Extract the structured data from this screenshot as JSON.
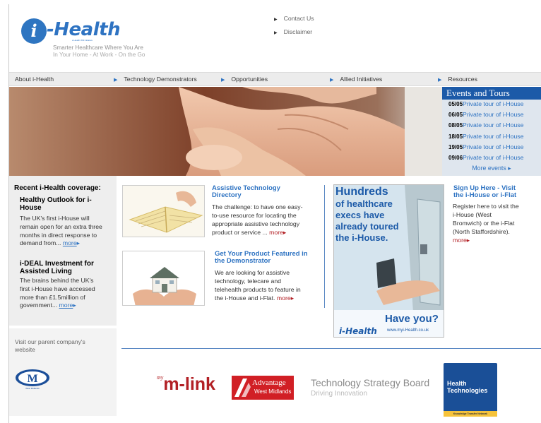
{
  "header": {
    "logo_mark": "i",
    "logo_text": "-Health",
    "logo_subtext": "a Health WM initiative",
    "tagline_1": "Smarter Healthcare Where You Are",
    "tagline_2": "In Your Home - At Work - On the Go",
    "top_links": [
      "Contact Us",
      "Disclaimer"
    ]
  },
  "nav": {
    "items": [
      "About i-Health",
      "Technology Demonstrators",
      "Opportunities",
      "Allied Initiatives",
      "Resources"
    ]
  },
  "events": {
    "title": "Events and Tours",
    "rows": [
      {
        "date": "05/05",
        "text": "Private tour of i-House"
      },
      {
        "date": "06/05",
        "text": "Private tour of i-House"
      },
      {
        "date": "08/05",
        "text": "Private tour of i-House"
      },
      {
        "date": "18/05",
        "text": "Private tour of i-House"
      },
      {
        "date": "19/05",
        "text": "Private tour of i-House"
      },
      {
        "date": "09/06",
        "text": "Private tour of i-House"
      }
    ],
    "more": "More events"
  },
  "recent": {
    "heading": "Recent i-Health coverage:",
    "stories": [
      {
        "title_1": "Healthy Outlook for i-",
        "title_2": "House",
        "body": [
          "The UK's first i-House will",
          "remain open for an extra three",
          "months in direct response to"
        ],
        "last_line": "demand from...",
        "more": "more"
      },
      {
        "title_1": "i-DEAL Investment for",
        "title_2": "Assisted Living",
        "body": [
          "The brains behind the UK's",
          "first i-House have accessed",
          "more than £1.5million of"
        ],
        "last_line": "government...",
        "more": "more"
      }
    ],
    "parent_text_1": "Visit our parent company's",
    "parent_text_2": "website",
    "parent_logo": "M",
    "parent_logo_sub": "West Midlands"
  },
  "features": [
    {
      "title_1": "Assistive Technology",
      "title_2": "Directory",
      "body": [
        "The challenge: to have one easy-",
        "to-use resource for locating the",
        "appropriate assistive technology"
      ],
      "last_line": "product or service ...",
      "more": "more"
    },
    {
      "title_1": "Get Your Product Featured in",
      "title_2": "the Demonstrator",
      "body": [
        "We are looking for assistive",
        "technology, telecare and",
        "telehealth products to feature in"
      ],
      "last_line": "the i-House and i-Flat.",
      "more": "more"
    }
  ],
  "ad": {
    "lines": [
      "Hundreds",
      "of healthcare",
      "execs have",
      "already toured",
      "the i-House."
    ],
    "have_you": "Have you?",
    "logo": "i-Health",
    "url": "www.myi-Health.co.uk"
  },
  "signup": {
    "title_1": "Sign Up Here - Visit",
    "title_2": "the i-House or i-Flat",
    "body": [
      "Register here to visit the",
      "i-House (West",
      "Bromwich) or the i-Flat",
      "(North Staffordshire)."
    ],
    "more": "more"
  },
  "sponsors": {
    "mlink_pre": "my",
    "mlink": "m-link",
    "advantage_1": "Advantage",
    "advantage_2": "West Midlands",
    "tsb_1": "Technology Strategy Board",
    "tsb_2": "Driving Innovation",
    "ht_1": "Health",
    "ht_2": "Technologies",
    "ht_bar": "Knowledge Transfer Network"
  },
  "colors": {
    "brand_blue": "#2e73c2",
    "events_header": "#1c5aa8",
    "nav_bg": "#ececec"
  }
}
